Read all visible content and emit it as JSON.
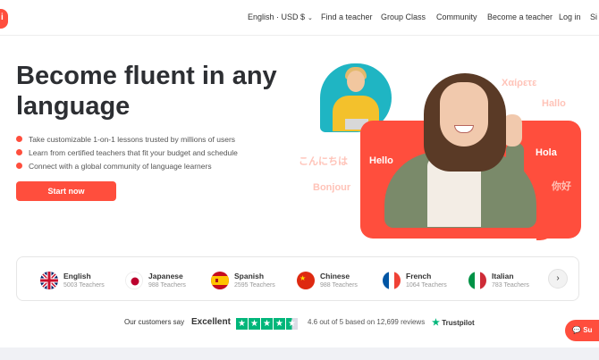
{
  "nav": {
    "logo_letter": "i",
    "locale_label": "English · USD $",
    "find_teacher": "Find a teacher",
    "group_class": "Group Class",
    "community": "Community",
    "become_teacher": "Become a teacher",
    "login": "Log in",
    "signup_partial": "Si"
  },
  "hero": {
    "title": "Become fluent in any language",
    "bullets": [
      "Take customizable 1-on-1 lessons trusted by millions of users",
      "Learn from certified teachers that fit your budget and schedule",
      "Connect with a global community of language learners"
    ],
    "cta": "Start now",
    "words": {
      "greek": "Χαίρετε",
      "hallo": "Hallo",
      "hola": "Hola",
      "hello": "Hello",
      "japanese": "こんにちは",
      "bonjour": "Bonjour",
      "chinese": "你好"
    },
    "colors": {
      "accent": "#ff4e3d",
      "teal": "#1fb5c3"
    }
  },
  "languages": [
    {
      "name": "English",
      "count": "5003 Teachers",
      "flag": "uk-flag-icon"
    },
    {
      "name": "Japanese",
      "count": "988 Teachers",
      "flag": "japan-flag-icon"
    },
    {
      "name": "Spanish",
      "count": "2595 Teachers",
      "flag": "spain-flag-icon"
    },
    {
      "name": "Chinese",
      "count": "988 Teachers",
      "flag": "china-flag-icon"
    },
    {
      "name": "French",
      "count": "1064 Teachers",
      "flag": "france-flag-icon"
    },
    {
      "name": "Italian",
      "count": "783 Teachers",
      "flag": "italy-flag-icon"
    }
  ],
  "reviews": {
    "say": "Our customers say",
    "rating_word": "Excellent",
    "score_text": "4.6 out of 5 based on 12,699 reviews",
    "brand": "Trustpilot",
    "stars": 4.5
  },
  "chat": {
    "label": "Su"
  }
}
